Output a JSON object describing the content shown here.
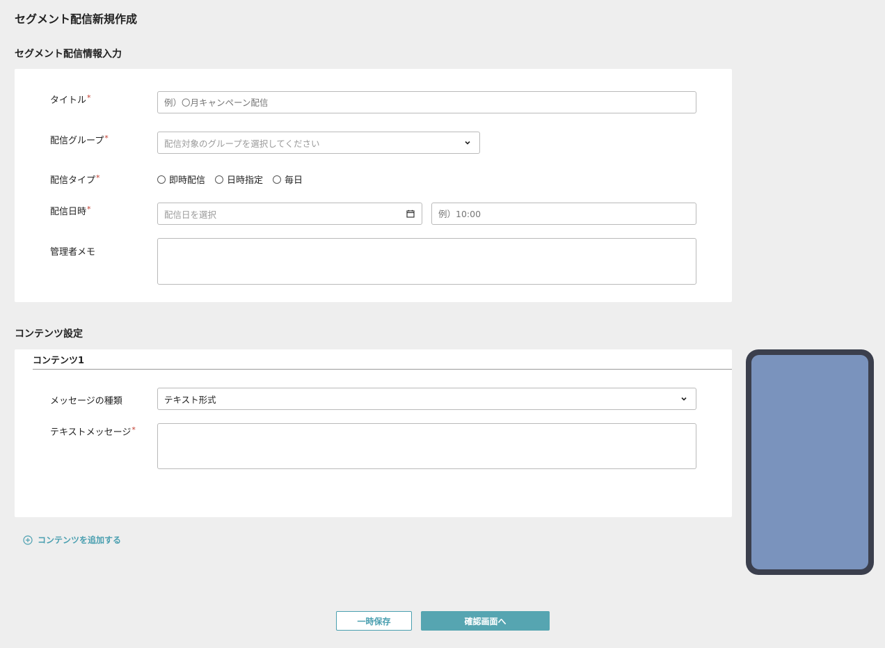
{
  "page": {
    "title": "セグメント配信新規作成"
  },
  "info_section": {
    "heading": "セグメント配信情報入力",
    "required_mark": "*",
    "title_field": {
      "label": "タイトル",
      "placeholder": "例）〇月キャンペーン配信"
    },
    "group_field": {
      "label": "配信グループ",
      "placeholder": "配信対象のグループを選択してください"
    },
    "type_field": {
      "label": "配信タイプ",
      "options": [
        "即時配信",
        "日時指定",
        "毎日"
      ]
    },
    "datetime_field": {
      "label": "配信日時",
      "date_placeholder": "配信日を選択",
      "time_placeholder": "例）10:00"
    },
    "memo_field": {
      "label": "管理者メモ"
    }
  },
  "content_section": {
    "heading": "コンテンツ設定",
    "content1": {
      "title": "コンテンツ1",
      "message_type": {
        "label": "メッセージの種類",
        "value": "テキスト形式"
      },
      "text_message": {
        "label": "テキストメッセージ"
      }
    },
    "add_link": "コンテンツを追加する"
  },
  "actions": {
    "save_draft": "一時保存",
    "confirm": "確認画面へ"
  },
  "colors": {
    "accent": "#56a5b1",
    "background": "#eeeeee",
    "phone_frame": "#3b3f4d",
    "phone_screen": "#7a93bd"
  },
  "icons": [
    "chevron-down-icon",
    "calendar-icon",
    "plus-circle-icon"
  ]
}
